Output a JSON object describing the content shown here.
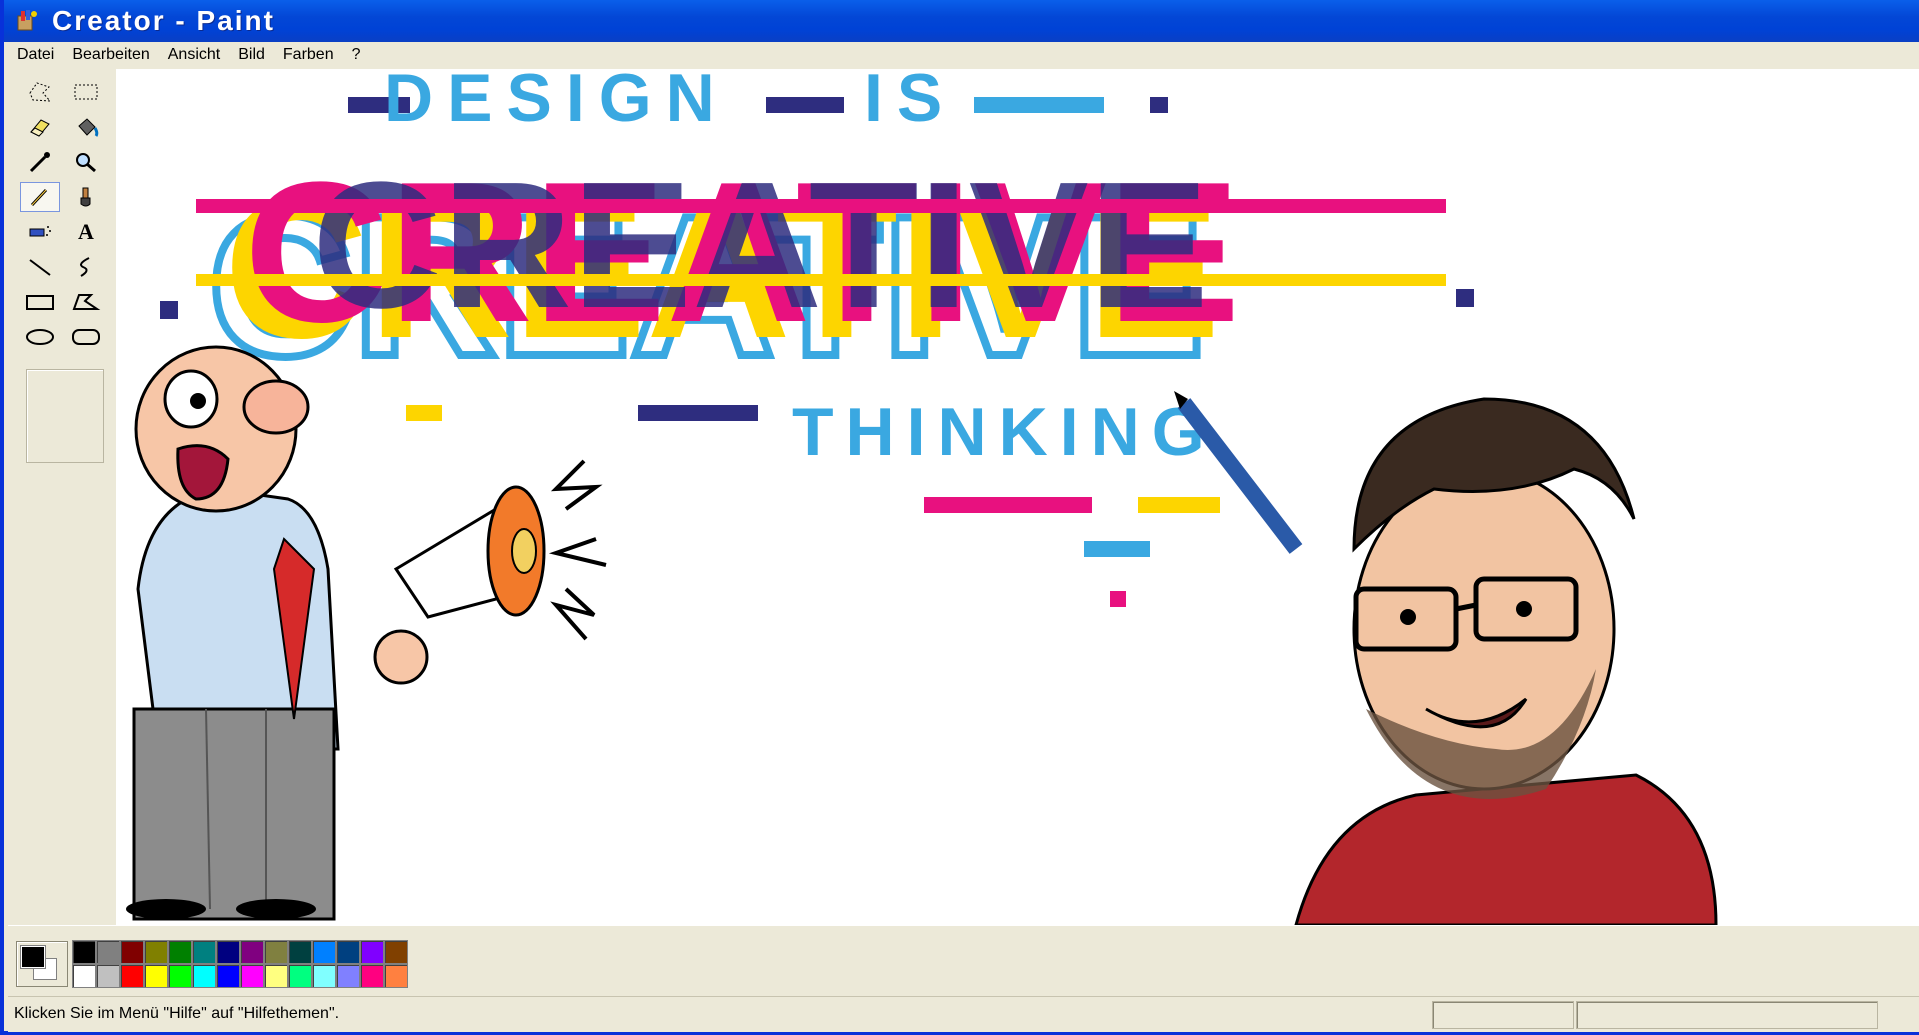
{
  "window": {
    "title": "Creator - Paint"
  },
  "menu": [
    "Datei",
    "Bearbeiten",
    "Ansicht",
    "Bild",
    "Farben",
    "?"
  ],
  "tools": [
    {
      "name": "free-select-icon"
    },
    {
      "name": "rect-select-icon"
    },
    {
      "name": "eraser-icon"
    },
    {
      "name": "fill-bucket-icon"
    },
    {
      "name": "color-picker-icon"
    },
    {
      "name": "magnifier-icon"
    },
    {
      "name": "pencil-icon",
      "selected": true
    },
    {
      "name": "brush-icon"
    },
    {
      "name": "airbrush-icon"
    },
    {
      "name": "text-icon",
      "glyph": "A"
    },
    {
      "name": "line-icon"
    },
    {
      "name": "curve-icon"
    },
    {
      "name": "rectangle-icon"
    },
    {
      "name": "polygon-icon"
    },
    {
      "name": "ellipse-icon"
    },
    {
      "name": "rounded-rect-icon"
    }
  ],
  "canvas": {
    "headline_top": "DESIGN",
    "headline_is": "IS",
    "headline_main": "CREATIVE",
    "headline_bottom": "THINKING",
    "colors": {
      "blue": "#3aa8e1",
      "navy": "#2e2d7f",
      "magenta": "#e8117f",
      "yellow": "#fdd500"
    }
  },
  "palette": {
    "foreground": "#000000",
    "background": "#ffffff",
    "colors": [
      "#000000",
      "#808080",
      "#800000",
      "#808000",
      "#008000",
      "#008080",
      "#000080",
      "#800080",
      "#808040",
      "#004040",
      "#0080ff",
      "#004080",
      "#8000ff",
      "#804000",
      "#ffffff",
      "#c0c0c0",
      "#ff0000",
      "#ffff00",
      "#00ff00",
      "#00ffff",
      "#0000ff",
      "#ff00ff",
      "#ffff80",
      "#00ff80",
      "#80ffff",
      "#8080ff",
      "#ff0080",
      "#ff8040"
    ]
  },
  "status": {
    "text": "Klicken Sie im Menü \"Hilfe\" auf \"Hilfethemen\"."
  }
}
